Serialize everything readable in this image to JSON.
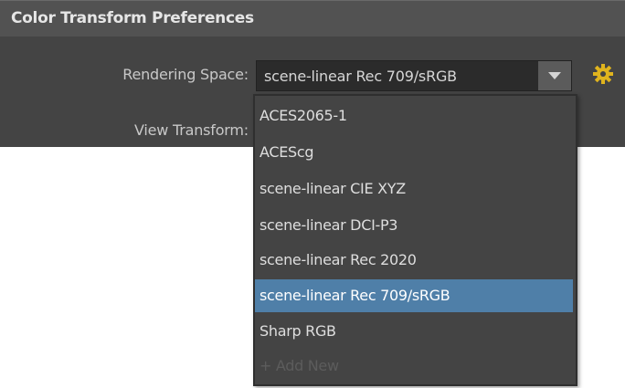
{
  "header": {
    "title": "Color Transform Preferences"
  },
  "form": {
    "rendering_space_label": "Rendering Space:",
    "view_transform_label": "View Transform:",
    "rendering_space_value": "scene-linear Rec 709/sRGB"
  },
  "dropdown": {
    "items": [
      {
        "label": "ACES2065-1"
      },
      {
        "label": "ACEScg"
      },
      {
        "label": "scene-linear CIE XYZ"
      },
      {
        "label": "scene-linear DCI-P3"
      },
      {
        "label": "scene-linear Rec 2020"
      },
      {
        "label": "scene-linear Rec 709/sRGB",
        "selected": true
      },
      {
        "label": "Sharp RGB"
      },
      {
        "label": "+ Add New",
        "disabled": true
      }
    ]
  },
  "icons": {
    "gear": "gear-icon",
    "dropdown_arrow": "chevron-down-icon"
  },
  "colors": {
    "header_bg": "#525252",
    "panel_bg": "#444444",
    "selection": "#4f7fa8",
    "gear": "#e0b41e"
  }
}
